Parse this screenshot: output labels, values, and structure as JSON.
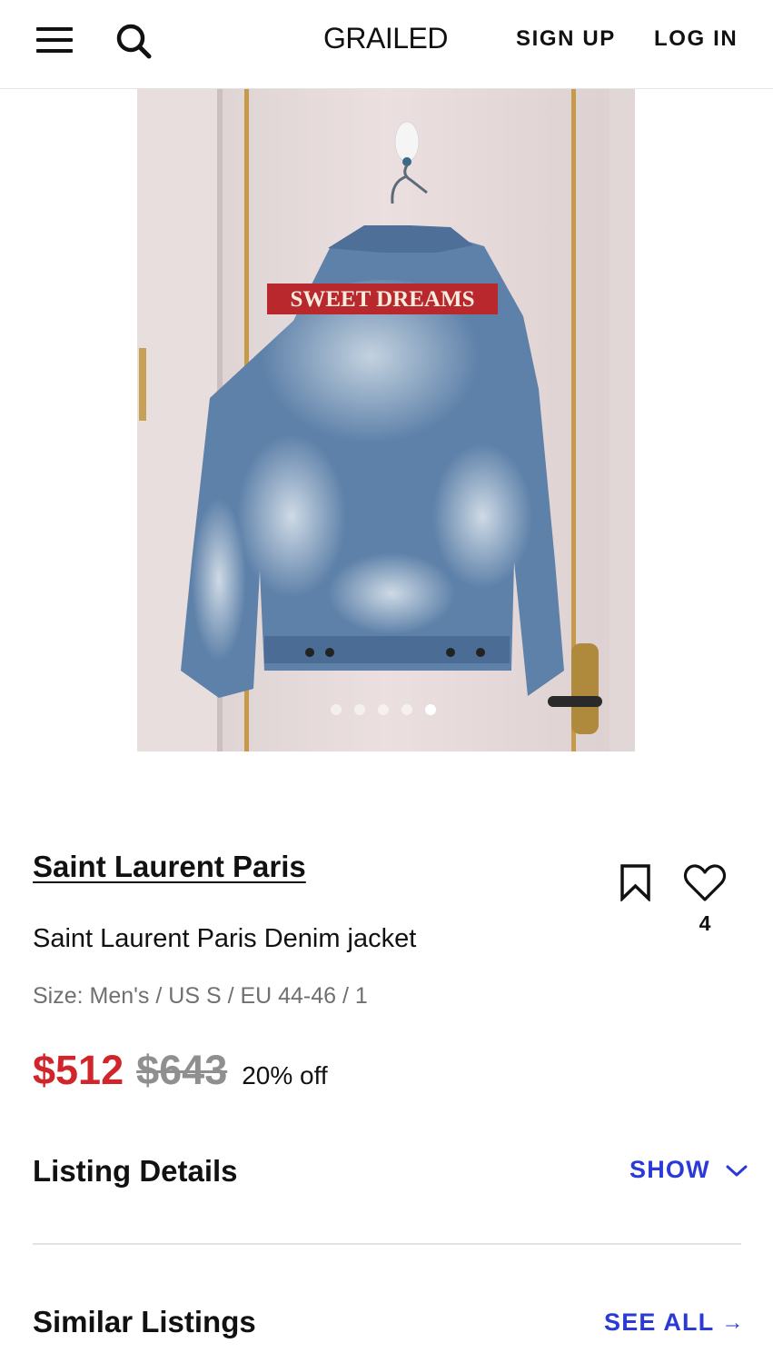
{
  "header": {
    "logo": "GRAILED",
    "signup_label": "SIGN UP",
    "login_label": "LOG IN"
  },
  "gallery": {
    "patch_text": "SWEET DREAMS",
    "image_count": 5,
    "active_index": 4
  },
  "listing": {
    "brand": "Saint Laurent Paris",
    "title": "Saint Laurent Paris Denim jacket",
    "size": "Size: Men's / US S / EU 44-46 / 1",
    "price": "$512",
    "original_price": "$643",
    "discount": "20% off",
    "like_count": "4"
  },
  "sections": {
    "details_title": "Listing Details",
    "show_label": "SHOW",
    "similar_title": "Similar Listings",
    "see_all_label": "SEE ALL",
    "see_all_arrow": "→"
  },
  "colors": {
    "price_red": "#d0262b",
    "link_blue": "#2a3ad6",
    "muted_gray": "#707070"
  },
  "icons": {
    "menu": "hamburger-icon",
    "search": "search-icon",
    "bookmark": "bookmark-icon",
    "like": "heart-icon",
    "expand": "chevron-down-icon",
    "see_all": "arrow-right-icon"
  }
}
